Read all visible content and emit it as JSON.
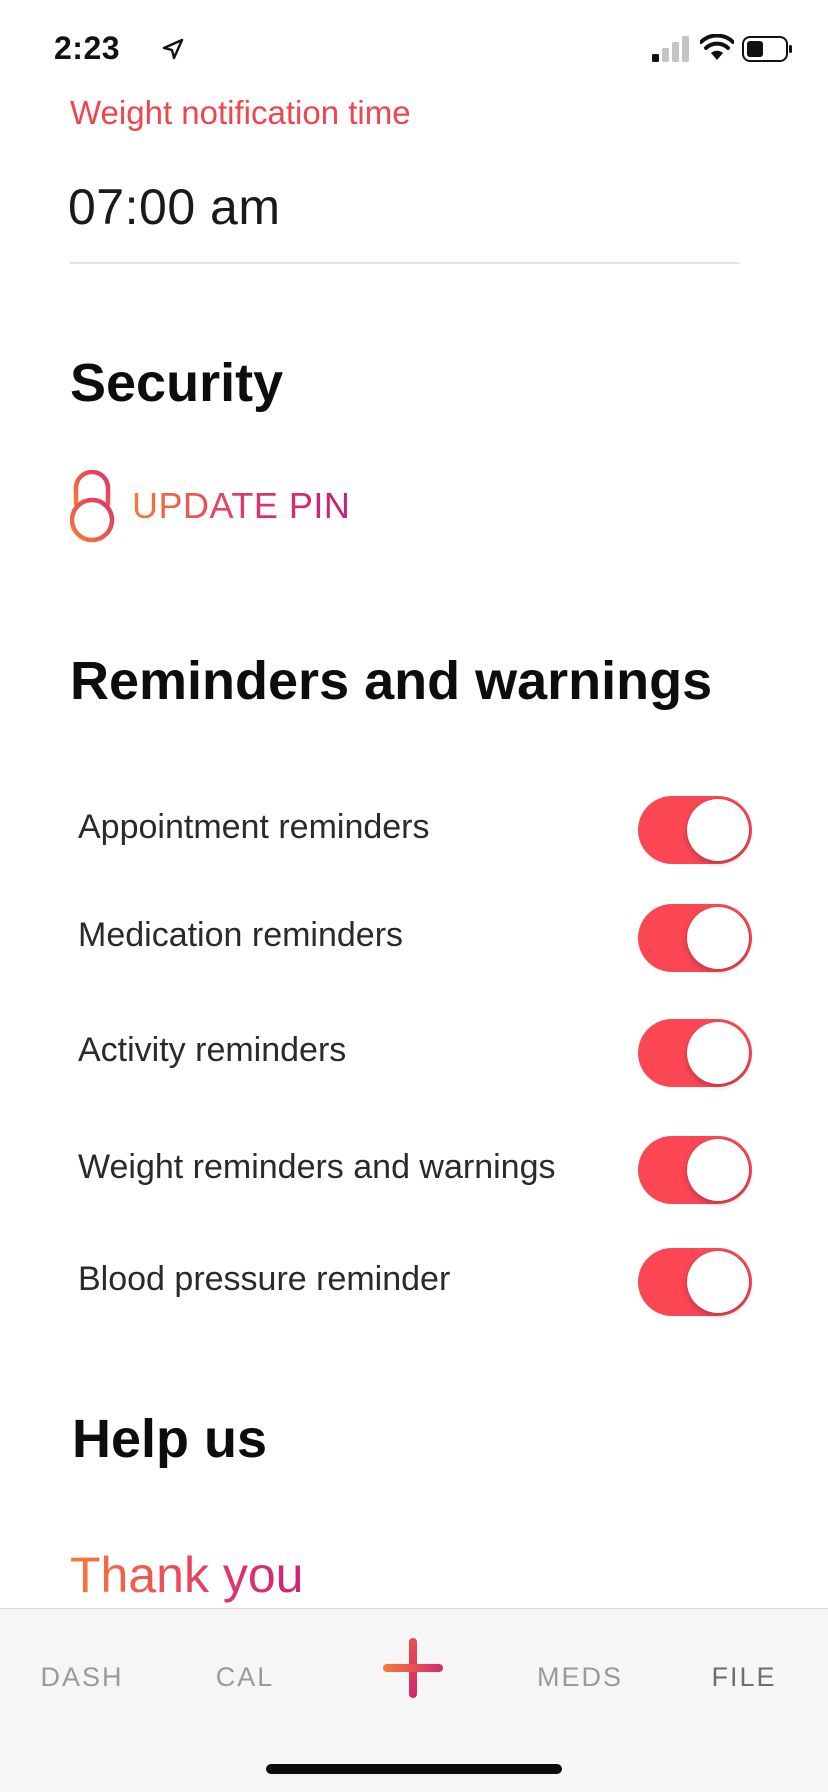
{
  "status_bar": {
    "time": "2:23",
    "icons": [
      "location-arrow-icon",
      "signal-icon",
      "wifi-icon",
      "battery-icon"
    ]
  },
  "weight_notification": {
    "label": "Weight notification time",
    "value": "07:00 am"
  },
  "security": {
    "title": "Security",
    "update_pin_label": "UPDATE PIN",
    "icon": "lock-icon"
  },
  "reminders": {
    "title": "Reminders and warnings",
    "items": [
      {
        "label": "Appointment reminders",
        "on": true
      },
      {
        "label": "Medication reminders",
        "on": true
      },
      {
        "label": "Activity reminders",
        "on": true
      },
      {
        "label": "Weight reminders and warnings",
        "on": true
      },
      {
        "label": "Blood pressure reminder",
        "on": true
      }
    ]
  },
  "help": {
    "title": "Help us",
    "thank_you": "Thank you"
  },
  "tab_bar": {
    "tabs": [
      {
        "label": "DASH"
      },
      {
        "label": "CAL"
      },
      {
        "label": "",
        "icon": "plus-icon"
      },
      {
        "label": "MEDS"
      },
      {
        "label": "FILE"
      }
    ]
  },
  "colors": {
    "accent_red": "#fb4654",
    "label_red": "#f0444f",
    "gradient_start": "#f47b39",
    "gradient_end": "#c8207a"
  }
}
